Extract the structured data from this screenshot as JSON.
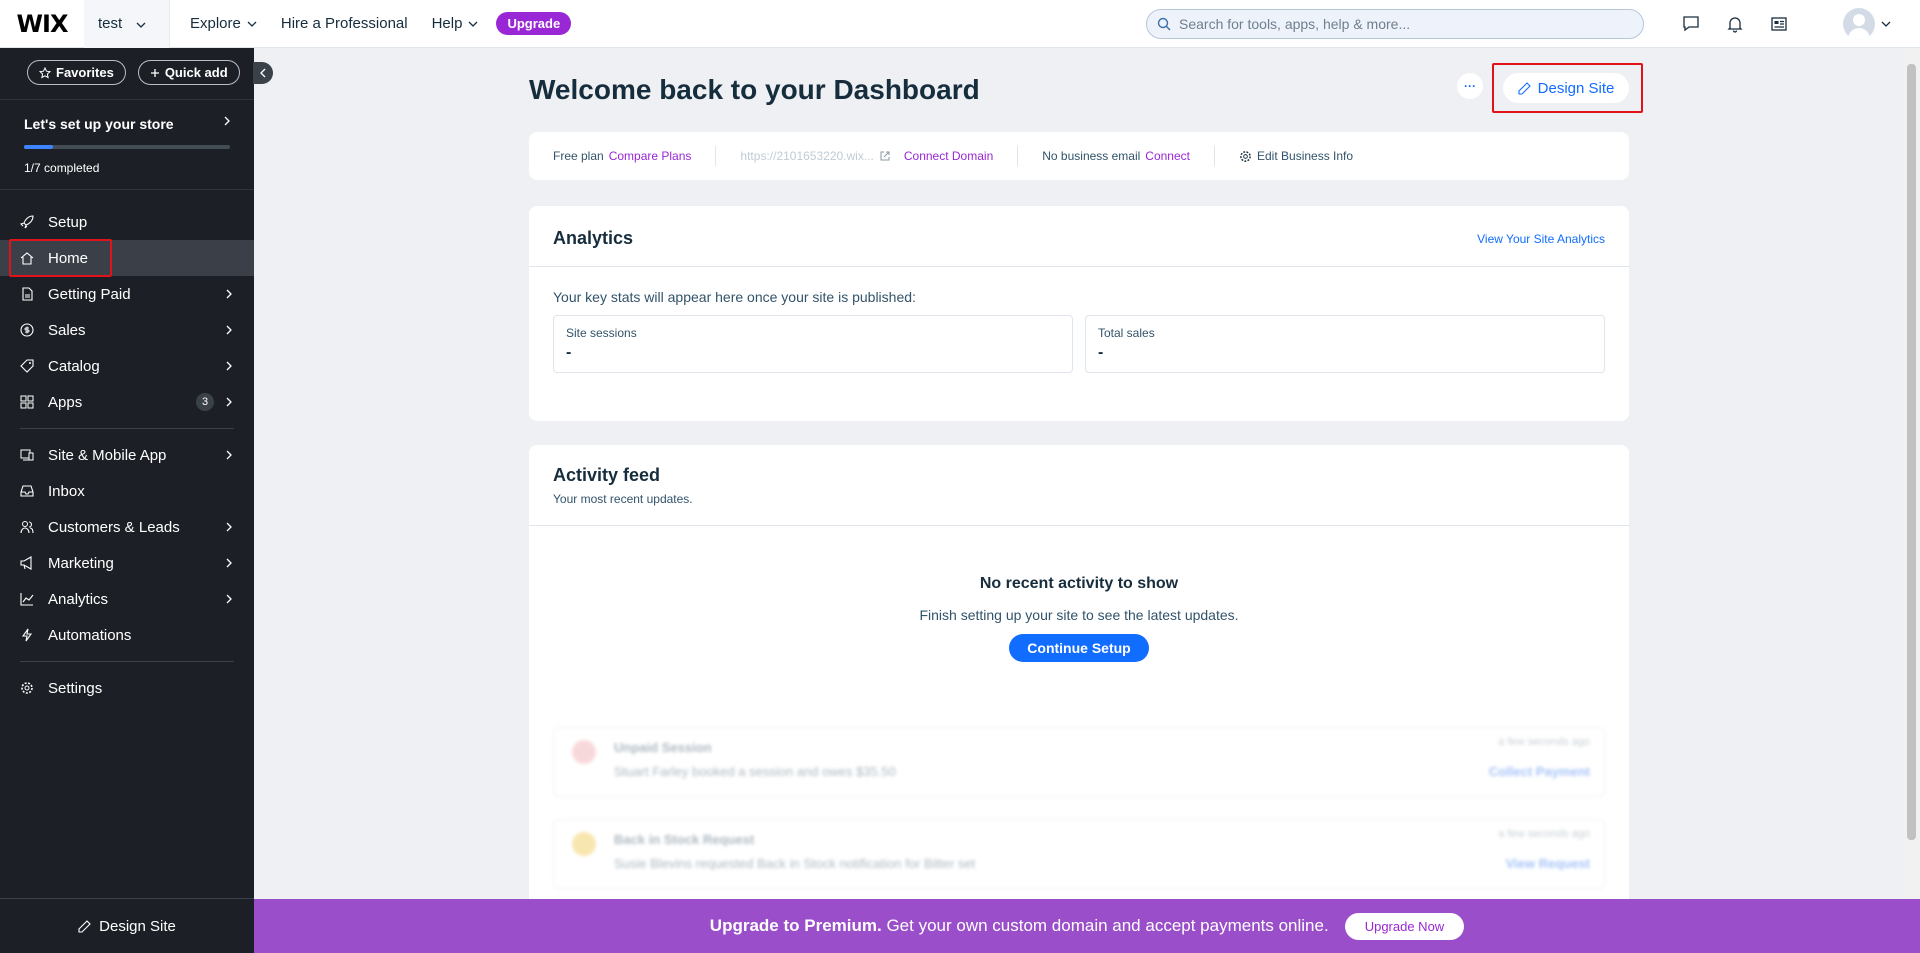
{
  "topbar": {
    "logo": "WIX",
    "site_name": "test",
    "nav": {
      "explore": "Explore",
      "hire": "Hire a Professional",
      "help": "Help",
      "upgrade": "Upgrade"
    },
    "search_placeholder": "Search for tools, apps, help & more..."
  },
  "sidebar": {
    "favorites": "Favorites",
    "quick_add": "Quick add",
    "setup_title": "Let's set up your store",
    "setup_progress_text": "1/7 completed",
    "setup_progress_fraction": 0.14,
    "items": {
      "setup": "Setup",
      "home": "Home",
      "getting_paid": "Getting Paid",
      "sales": "Sales",
      "catalog": "Catalog",
      "apps": "Apps",
      "apps_badge": "3",
      "site_mobile": "Site & Mobile App",
      "inbox": "Inbox",
      "customers": "Customers & Leads",
      "marketing": "Marketing",
      "analytics": "Analytics",
      "automations": "Automations",
      "settings": "Settings"
    },
    "bottom_design": "Design Site"
  },
  "main": {
    "title": "Welcome back to your Dashboard",
    "more": "···",
    "design_site": "Design Site",
    "info": {
      "plan": "Free plan",
      "compare": "Compare Plans",
      "url": "https://2101653220.wix...",
      "connect_domain": "Connect Domain",
      "no_email": "No business email",
      "connect": "Connect",
      "edit_business": "Edit Business Info"
    },
    "analytics": {
      "title": "Analytics",
      "view_link": "View Your Site Analytics",
      "note": "Your key stats will appear here once your site is published:",
      "sessions_label": "Site sessions",
      "sessions_value": "-",
      "sales_label": "Total sales",
      "sales_value": "-"
    },
    "activity": {
      "title": "Activity feed",
      "subtitle": "Your most recent updates.",
      "empty_title": "No recent activity to show",
      "empty_desc": "Finish setting up your site to see the latest updates.",
      "continue": "Continue Setup",
      "ghost": [
        {
          "title": "Unpaid Session",
          "desc": "Stuart Farley booked a session and owes $35.50",
          "time": "a few seconds ago",
          "action": "Collect Payment"
        },
        {
          "title": "Back in Stock Request",
          "desc": "Susie Blevins requested Back in Stock notification for Bitter set",
          "time": "a few seconds ago",
          "action": "View Request"
        }
      ]
    }
  },
  "banner": {
    "bold": "Upgrade to Premium.",
    "text": "Get your own custom domain and accept payments online.",
    "button": "Upgrade Now"
  },
  "colors": {
    "accent": "#116dff",
    "brand_purple": "#9a27d5",
    "sidebar_bg": "#1c2026",
    "banner_bg": "#9a4ec9"
  }
}
